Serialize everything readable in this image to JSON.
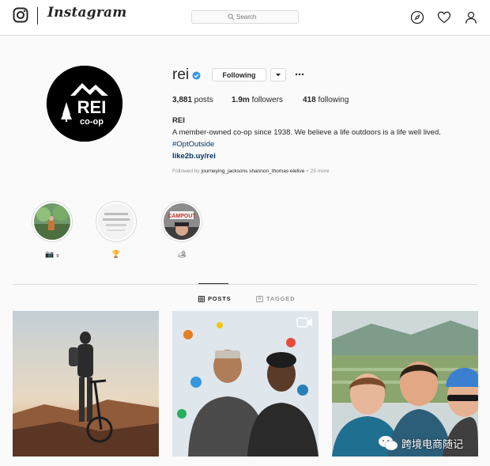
{
  "header": {
    "wordmark": "Instagram",
    "search_placeholder": "Search",
    "icons": [
      "camera-logo-icon",
      "compass-icon",
      "heart-icon",
      "person-icon"
    ]
  },
  "profile": {
    "username": "rei",
    "follow_label": "Following",
    "stats": {
      "posts_count": "3,881",
      "posts_label": " posts",
      "followers_count": "1.9m",
      "followers_label": " followers",
      "following_count": "418",
      "following_label": " following"
    },
    "full_name": "REI",
    "bio": "A member-owned co-op since 1938. We believe a life outdoors is a life well lived.",
    "hashtag": "#OptOutside",
    "link": "like2b.uy/rei",
    "followed_by_prefix": "Followed by ",
    "followed_by_names": "journeying_jacksons  shannon_thomas  elelive",
    "followed_by_suffix": " + 25 more",
    "avatar_text": {
      "main": "REI",
      "sub": "co-op"
    }
  },
  "highlights": [
    {
      "label": "📷 ₉",
      "name": "highlight-1"
    },
    {
      "label": "🏆",
      "name": "highlight-2"
    },
    {
      "label": "🏕",
      "name": "highlight-3"
    }
  ],
  "highlight_texts": {
    "h2": "Gear\nbuy",
    "h3": "CAMPOUT"
  },
  "tabs": {
    "posts": "POSTS",
    "tagged": "TAGGED"
  },
  "watermark": "跨境电商随记",
  "colors": {
    "link": "#003569",
    "verified": "#3897f0",
    "border": "#dbdbdb"
  }
}
